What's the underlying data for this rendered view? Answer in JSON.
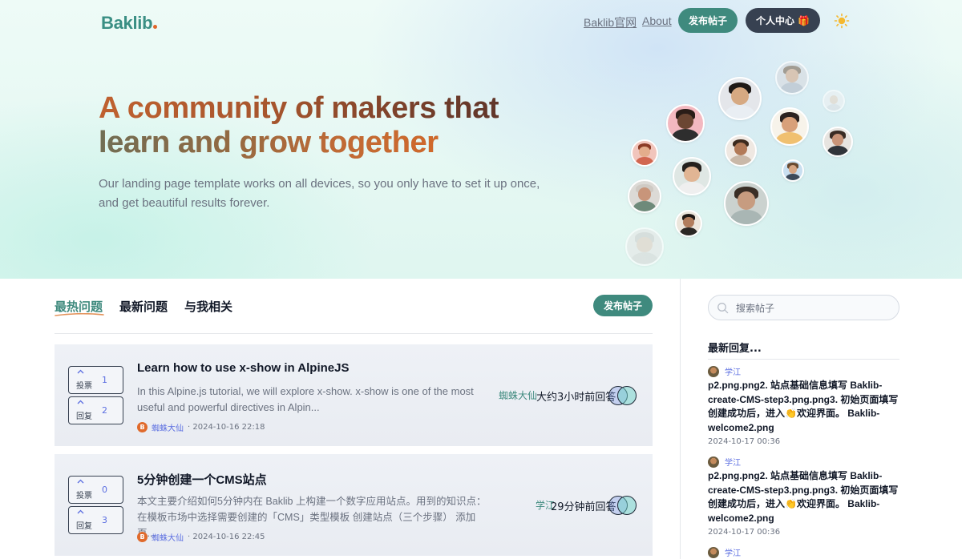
{
  "header": {
    "logo": "Baklib",
    "nav": [
      "Baklib官网",
      "About"
    ],
    "post_button": "发布帖子",
    "profile_button": "个人中心 🎁"
  },
  "hero": {
    "title_line1": "A community of makers that",
    "title_line2": "learn and grow together",
    "subtitle": "Our landing page template works on all devices, so you only have to set it up once, and get beautiful results forever."
  },
  "tabs": {
    "items": [
      "最热问题",
      "最新问题",
      "与我相关"
    ],
    "active": 0,
    "post_button": "发布帖子"
  },
  "posts": [
    {
      "votes_label": "投票",
      "votes": "1",
      "replies_label": "回复",
      "replies": "2",
      "title": "Learn how to use x-show in AlpineJS",
      "desc": "In this Alpine.js tutorial, we will explore x-show. x-show is one of the most useful and powerful directives in Alpin...",
      "author": "蜘蛛大仙",
      "date": "· 2024-10-16 22:18",
      "last_reply_name": "蜘蛛大仙",
      "last_reply_time": "大约3小时前回答"
    },
    {
      "votes_label": "投票",
      "votes": "0",
      "replies_label": "回复",
      "replies": "3",
      "title": "5分钟创建一个CMS站点",
      "desc": "本文主要介绍如何5分钟内在 Baklib 上构建一个数字应用站点。用到的知识点：在模板市场中选择需要创建的「CMS」类型模板 创建站点（三个步骤） 添加页...",
      "author": "蜘蛛大仙",
      "date": "· 2024-10-16 22:45",
      "last_reply_name": "学江",
      "last_reply_time": "29分钟前回答"
    }
  ],
  "sidebar": {
    "search_placeholder": "搜索帖子",
    "title": "最新回复...",
    "replies": [
      {
        "name": "学江",
        "text": "p2.png.png2. 站点基础信息填写 Baklib-create-CMS-step3.png.png3. 初始页面填写 创建成功后，进入👏欢迎界面。 Baklib-welcome2.png",
        "date": "2024-10-17 00:36"
      },
      {
        "name": "学江",
        "text": "p2.png.png2. 站点基础信息填写 Baklib-create-CMS-step3.png.png3. 初始页面填写 创建成功后，进入👏欢迎界面。 Baklib-welcome2.png",
        "date": "2024-10-17 00:36"
      },
      {
        "name": "学江"
      }
    ]
  }
}
